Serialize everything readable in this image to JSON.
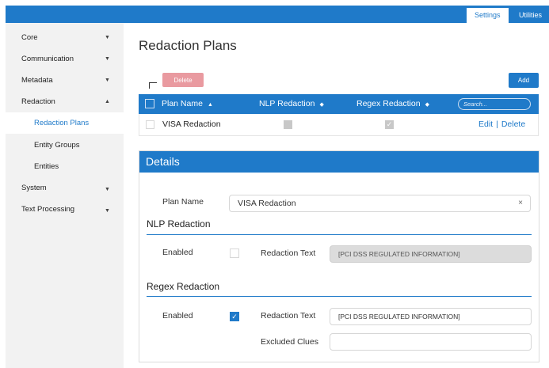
{
  "topbar": {
    "tabs": [
      {
        "label": "Settings"
      },
      {
        "label": "Utilities"
      }
    ]
  },
  "sidebar": {
    "items": [
      {
        "label": "Core",
        "chevron": "▼"
      },
      {
        "label": "Communication",
        "chevron": "▼"
      },
      {
        "label": "Metadata",
        "chevron": "▼"
      },
      {
        "label": "Redaction",
        "chevron": "▲"
      },
      {
        "label": "System",
        "chevron": "▼"
      },
      {
        "label": "Text Processing",
        "chevron": "▼"
      }
    ],
    "subitems": [
      {
        "label": "Redaction Plans"
      },
      {
        "label": "Entity Groups"
      },
      {
        "label": "Entities"
      }
    ]
  },
  "page": {
    "title": "Redaction Plans",
    "delete_label": "Delete",
    "add_label": "Add"
  },
  "table": {
    "columns": [
      {
        "label": "Plan Name",
        "sort": "▲"
      },
      {
        "label": "NLP Redaction",
        "sort": "◆"
      },
      {
        "label": "Regex Redaction",
        "sort": "◆"
      }
    ],
    "search_placeholder": "Search...",
    "rows": [
      {
        "name": "VISA Redaction",
        "nlp": false,
        "regex": true,
        "edit_label": "Edit",
        "separator": "|",
        "delete_label": "Delete"
      }
    ]
  },
  "details": {
    "title": "Details",
    "plan_name_label": "Plan Name",
    "plan_name_value": "VISA Redaction",
    "clear_glyph": "×",
    "nlp": {
      "title": "NLP Redaction",
      "enabled_label": "Enabled",
      "enabled": false,
      "redaction_text_label": "Redaction Text",
      "redaction_text_value": "[PCI DSS REGULATED INFORMATION]"
    },
    "regex": {
      "title": "Regex Redaction",
      "enabled_label": "Enabled",
      "enabled": true,
      "check_glyph": "✓",
      "redaction_text_label": "Redaction Text",
      "redaction_text_value": "[PCI DSS REGULATED INFORMATION]",
      "excluded_clues_label": "Excluded Clues",
      "excluded_clues_value": ""
    }
  },
  "colors": {
    "accent": "#1f7ac9",
    "delete_button": "#e99aa0",
    "sidebar_bg": "#f2f2f2"
  }
}
